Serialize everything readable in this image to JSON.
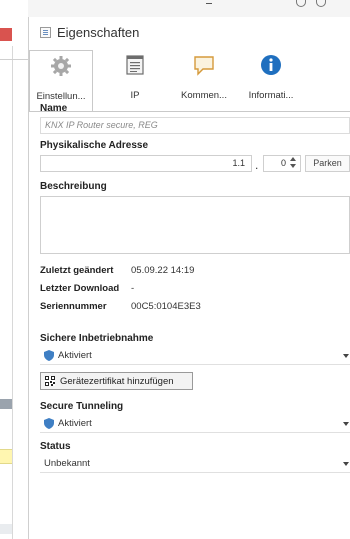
{
  "panel": {
    "title": "Eigenschaften"
  },
  "tabs": [
    {
      "label": "Einstellun...",
      "icon": "gear-icon"
    },
    {
      "label": "IP",
      "icon": "ip-icon"
    },
    {
      "label": "Kommen...",
      "icon": "comment-icon"
    },
    {
      "label": "Informati...",
      "icon": "info-icon"
    }
  ],
  "name": {
    "label": "Name",
    "placeholder": "KNX IP Router secure, REG"
  },
  "address": {
    "label": "Physikalische Adresse",
    "main": "1.1",
    "separator": ".",
    "device": "0",
    "park_label": "Parken"
  },
  "description": {
    "label": "Beschreibung",
    "value": ""
  },
  "info": {
    "changed_key": "Zuletzt geändert",
    "changed_val": "05.09.22 14:19",
    "download_key": "Letzter Download",
    "download_val": "-",
    "serial_key": "Seriennummer",
    "serial_val": "00C5:0104E3E3"
  },
  "secure_commissioning": {
    "label": "Sichere Inbetriebnahme",
    "value": "Aktiviert"
  },
  "certificate_button": {
    "label": "Gerätezertifikat hinzufügen"
  },
  "secure_tunneling": {
    "label": "Secure Tunneling",
    "value": "Aktiviert"
  },
  "status": {
    "label": "Status",
    "value": "Unbekannt"
  },
  "colors": {
    "accent": "#1f6fbf",
    "shield": "#3f7fc4",
    "left_marker": "#d9534f"
  }
}
